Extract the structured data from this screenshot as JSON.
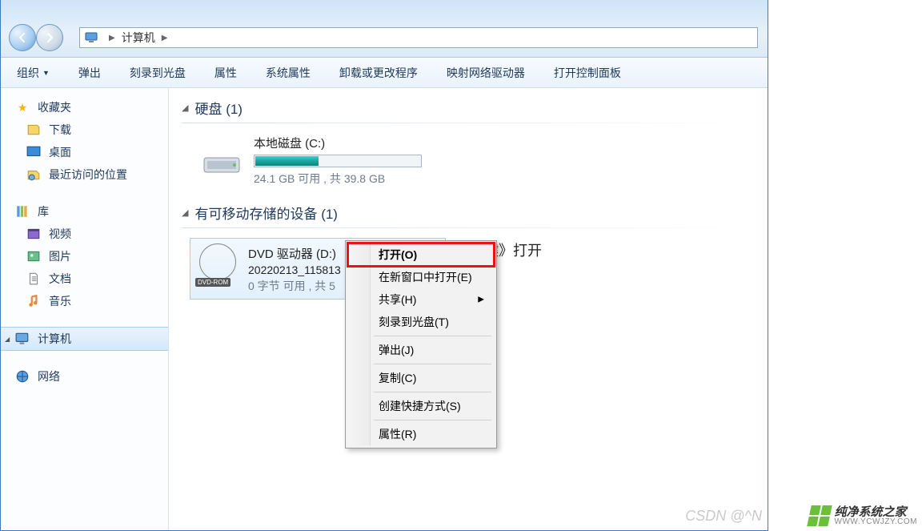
{
  "nav": {
    "back_aria": "后退",
    "forward_aria": "前进"
  },
  "address": {
    "root": "计算机",
    "sep": "▶"
  },
  "toolbar": {
    "organize": "组织",
    "eject": "弹出",
    "burn": "刻录到光盘",
    "properties": "属性",
    "sys_properties": "系统属性",
    "uninstall": "卸载或更改程序",
    "map_drive": "映射网络驱动器",
    "control_panel": "打开控制面板"
  },
  "sidebar": {
    "favorites": "收藏夹",
    "downloads": "下载",
    "desktop": "桌面",
    "recent": "最近访问的位置",
    "libraries": "库",
    "videos": "视频",
    "pictures": "图片",
    "documents": "文档",
    "music": "音乐",
    "computer": "计算机",
    "network": "网络"
  },
  "sections": {
    "hdd": "硬盘 (1)",
    "removable": "有可移动存储的设备 (1)"
  },
  "hdd": {
    "name": "本地磁盘 (C:)",
    "status": "24.1 GB 可用 , 共 39.8 GB"
  },
  "dvd": {
    "name": "DVD 驱动器 (D:)",
    "label": "20220213_115813",
    "status": "0 字节 可用 , 共 5",
    "badge": "DVD-ROM"
  },
  "hint": "右键》打开",
  "context_menu": {
    "open": "打开(O)",
    "open_new": "在新窗口中打开(E)",
    "share": "共享(H)",
    "burn": "刻录到光盘(T)",
    "eject": "弹出(J)",
    "copy": "复制(C)",
    "shortcut": "创建快捷方式(S)",
    "properties": "属性(R)"
  },
  "watermark": {
    "csdn": "CSDN @^N",
    "brand": "纯净系统之家",
    "url": "WWW.YCWJZY.COM"
  }
}
